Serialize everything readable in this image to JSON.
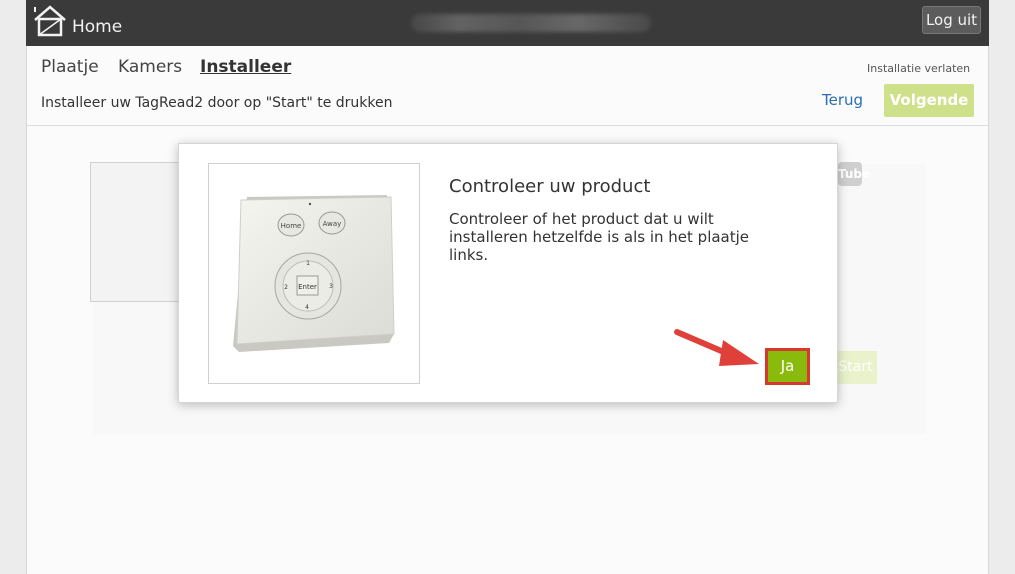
{
  "header": {
    "title": "Home",
    "logout_label": "Log uit"
  },
  "nav": {
    "tabs": [
      {
        "label": "Plaatje"
      },
      {
        "label": "Kamers"
      },
      {
        "label": "Installeer"
      }
    ],
    "leave_label": "Installatie verlaten"
  },
  "step": {
    "instruction": "Installeer uw TagRead2 door op \"Start\" te drukken",
    "back_label": "Terug",
    "next_label": "Volgende"
  },
  "modal": {
    "title": "Controleer uw product",
    "text": "Controleer of het product dat u wilt installeren hetzelfde is als in het plaatje links.",
    "confirm_label": "Ja",
    "device": {
      "home_label": "Home",
      "away_label": "Away",
      "enter_label": "Enter",
      "keys": [
        "1",
        "2",
        "3",
        "4"
      ]
    }
  },
  "background": {
    "start_label": "Start",
    "youtube_label": "Tube"
  },
  "colors": {
    "topbar": "#3a3a3a",
    "accent_green": "#8aba0c",
    "next_disabled": "#cfe08a",
    "highlight_red": "#d6392e",
    "link_blue": "#2a6db3"
  }
}
